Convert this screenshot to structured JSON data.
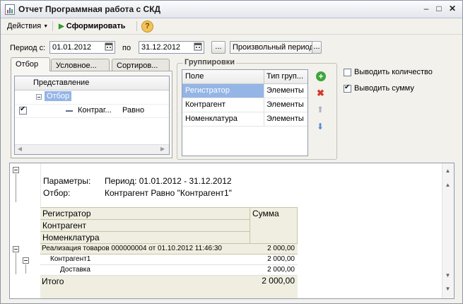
{
  "window": {
    "title": "Отчет  Программная работа с СКД"
  },
  "toolbar": {
    "actions_label": "Действия",
    "generate_label": "Сформировать",
    "help_label": "?"
  },
  "period": {
    "label_from": "Период с:",
    "date_from": "01.01.2012",
    "label_to": "по",
    "date_to": "31.12.2012",
    "choose_label": "...",
    "period_variant": "Произвольный период",
    "variant_btn": "..."
  },
  "tabs": [
    {
      "label": "Отбор"
    },
    {
      "label": "Условное..."
    },
    {
      "label": "Сортиров..."
    }
  ],
  "filter": {
    "header": "Представление",
    "rows": [
      {
        "name": "Отбор"
      },
      {
        "name": "Контраг...",
        "comparison": "Равно"
      }
    ]
  },
  "groupings": {
    "title": "Группировки",
    "headers": [
      "Поле",
      "Тип груп..."
    ],
    "rows": [
      {
        "field": "Регистратор",
        "type": "Элементы"
      },
      {
        "field": "Контрагент",
        "type": "Элементы"
      },
      {
        "field": "Номенклатура",
        "type": "Элементы"
      }
    ]
  },
  "options": {
    "show_quantity": "Выводить количество",
    "show_quantity_checked": false,
    "show_sum": "Выводить сумму",
    "show_sum_checked": true
  },
  "report": {
    "params_label": "Параметры:",
    "params_value": "Период: 01.01.2012 - 31.12.2012",
    "filter_label": "Отбор:",
    "filter_value": "Контрагент Равно \"Контрагент1\"",
    "header_rows": [
      "Регистратор",
      "Контрагент",
      "Номенклатура"
    ],
    "sum_header": "Сумма",
    "rows": [
      {
        "name": "Реализация товаров 000000004 от 01.10.2012 11:46:30",
        "sum": "2 000,00"
      },
      {
        "name": "Контрагент1",
        "sum": "2 000,00"
      },
      {
        "name": "Доставка",
        "sum": "2 000,00"
      }
    ],
    "total_label": "Итого",
    "total_sum": "2 000,00"
  },
  "colors": {
    "selection": "#94b5e6",
    "report_header": "#f0eee0",
    "accent_green": "#2f9a2f"
  }
}
